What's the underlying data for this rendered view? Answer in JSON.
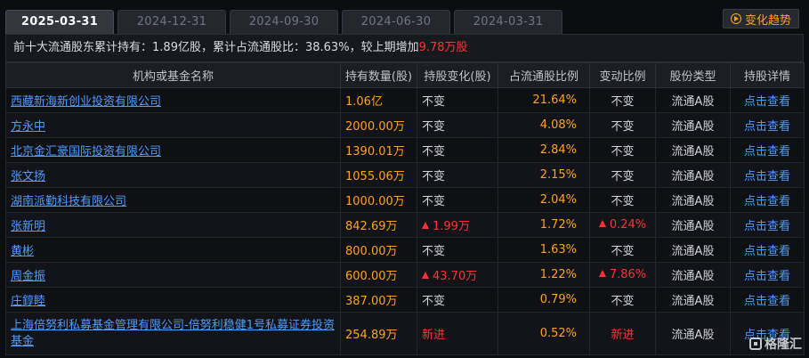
{
  "tabs": [
    "2025-03-31",
    "2024-12-31",
    "2024-09-30",
    "2024-06-30",
    "2024-03-31"
  ],
  "active_tab": 0,
  "trend_button": "变化趋势",
  "summary": {
    "prefix": "前十大流通股东累计持有：",
    "total": "1.89亿股",
    "ratio_label": "，累计占流通股比：",
    "ratio": "38.63%",
    "compare_label": "，较上期增加",
    "increase": "9.78万股"
  },
  "columns": [
    "机构或基金名称",
    "持有数量(股)",
    "持股变化(股)",
    "占流通股比例",
    "变动比例",
    "股份类型",
    "持股详情"
  ],
  "rows": [
    {
      "name": "西藏新海新创业投资有限公司",
      "hold": "1.06亿",
      "change": "不变",
      "change_up": false,
      "ratio": "21.64%",
      "vary": "不变",
      "vary_up": false,
      "type": "流通A股",
      "detail": "点击查看"
    },
    {
      "name": "方永中",
      "hold": "2000.00万",
      "change": "不变",
      "change_up": false,
      "ratio": "4.08%",
      "vary": "不变",
      "vary_up": false,
      "type": "流通A股",
      "detail": "点击查看"
    },
    {
      "name": "北京金汇豪国际投资有限公司",
      "hold": "1390.01万",
      "change": "不变",
      "change_up": false,
      "ratio": "2.84%",
      "vary": "不变",
      "vary_up": false,
      "type": "流通A股",
      "detail": "点击查看"
    },
    {
      "name": "张文扬",
      "hold": "1055.06万",
      "change": "不变",
      "change_up": false,
      "ratio": "2.15%",
      "vary": "不变",
      "vary_up": false,
      "type": "流通A股",
      "detail": "点击查看"
    },
    {
      "name": "湖南派勤科技有限公司",
      "hold": "1000.00万",
      "change": "不变",
      "change_up": false,
      "ratio": "2.04%",
      "vary": "不变",
      "vary_up": false,
      "type": "流通A股",
      "detail": "点击查看"
    },
    {
      "name": "张新明",
      "hold": "842.69万",
      "change": "1.99万",
      "change_up": true,
      "ratio": "1.72%",
      "vary": "0.24%",
      "vary_up": true,
      "type": "流通A股",
      "detail": "点击查看"
    },
    {
      "name": "黄彬",
      "hold": "800.00万",
      "change": "不变",
      "change_up": false,
      "ratio": "1.63%",
      "vary": "不变",
      "vary_up": false,
      "type": "流通A股",
      "detail": "点击查看"
    },
    {
      "name": "周金振",
      "hold": "600.00万",
      "change": "43.70万",
      "change_up": true,
      "ratio": "1.22%",
      "vary": "7.86%",
      "vary_up": true,
      "type": "流通A股",
      "detail": "点击查看"
    },
    {
      "name": "庄錞睦",
      "hold": "387.00万",
      "change": "不变",
      "change_up": false,
      "ratio": "0.79%",
      "vary": "不变",
      "vary_up": false,
      "type": "流通A股",
      "detail": "点击查看"
    },
    {
      "name": "上海倍努利私募基金管理有限公司-倍努利稳健1号私募证券投资基金",
      "hold": "254.89万",
      "change": "新进",
      "change_up": true,
      "ratio": "0.52%",
      "vary": "新进",
      "vary_up": true,
      "type": "流通A股",
      "detail": "点击查看"
    }
  ],
  "watermark": "格隆汇",
  "colors": {
    "accent_orange": "#ffa31a",
    "up_red": "#ff3333",
    "link_blue": "#4d9cff"
  }
}
